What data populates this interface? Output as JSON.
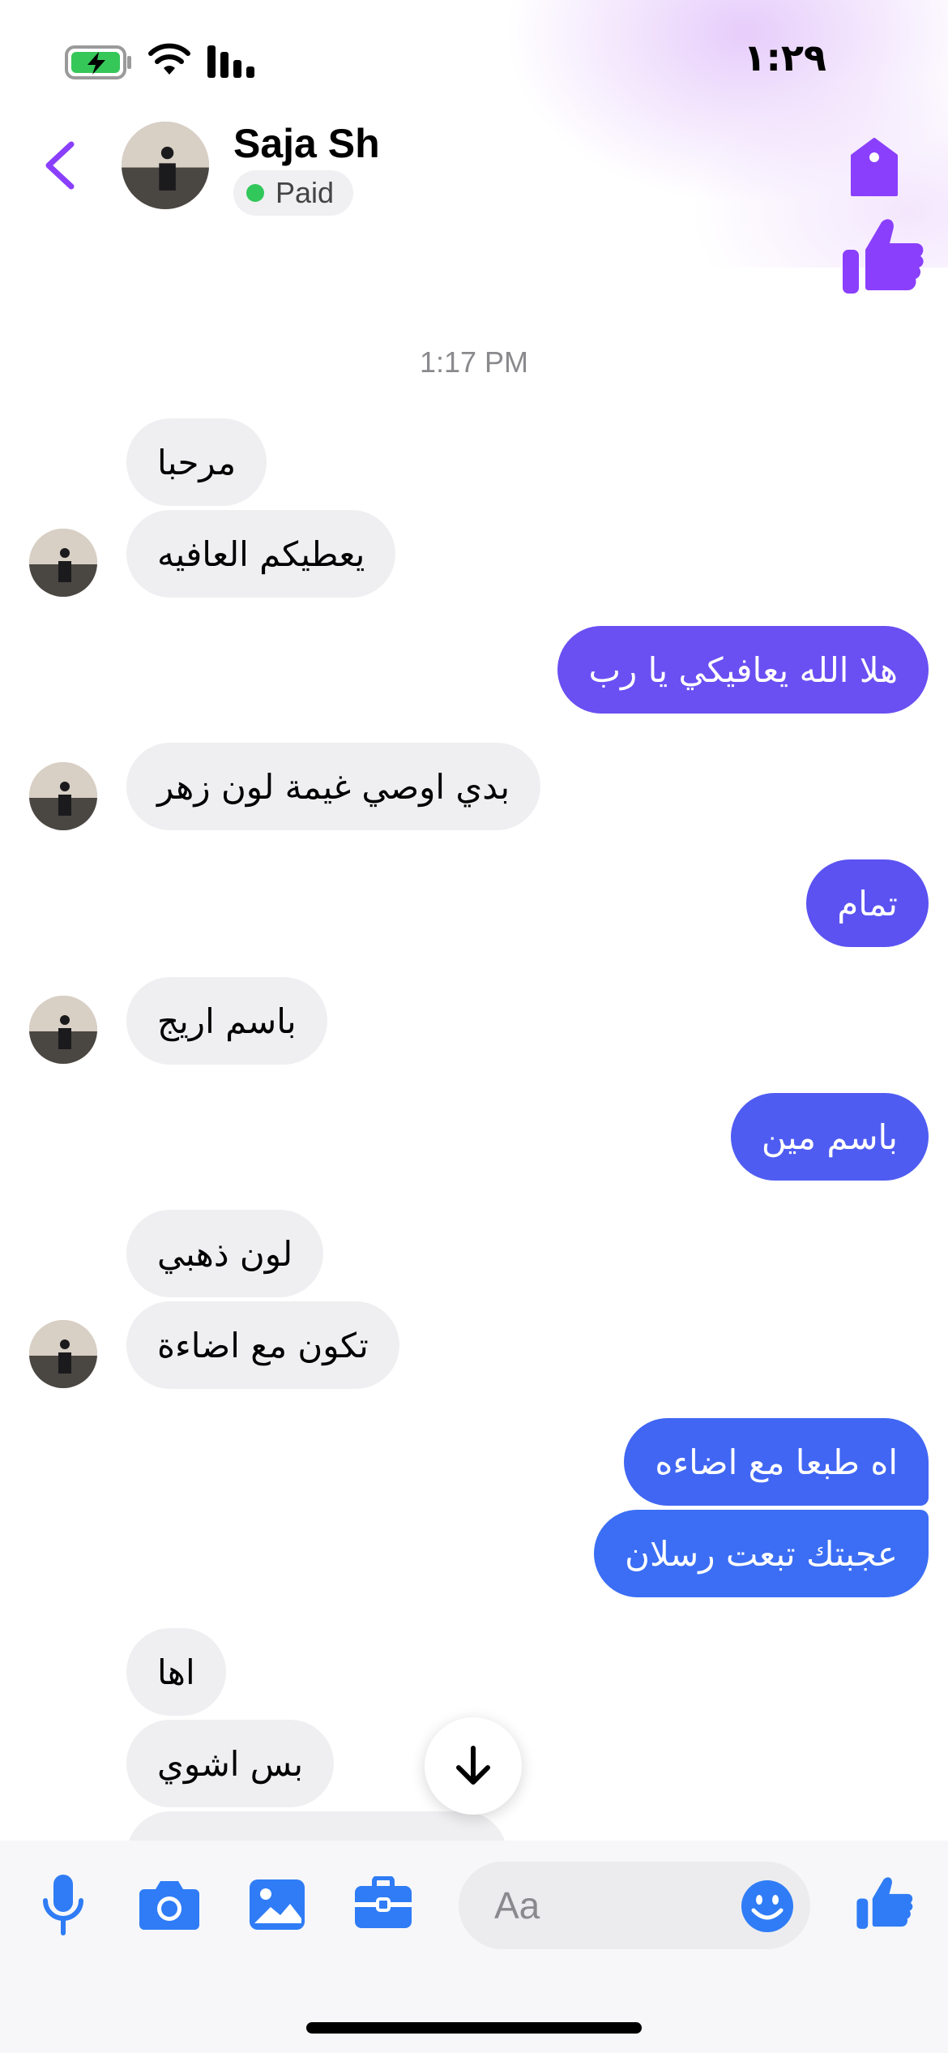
{
  "status_bar": {
    "time": "١:٢٩"
  },
  "header": {
    "contact_name": "Saja Sh",
    "label_tag": "Paid",
    "icons": [
      "back-chevron-icon",
      "tag-icon",
      "thumbs-up-icon"
    ]
  },
  "conversation": {
    "timestamp": "1:17 PM",
    "messages": [
      {
        "direction": "incoming",
        "text": "مرحبا"
      },
      {
        "direction": "incoming",
        "text": "يعطيكم العافيه"
      },
      {
        "direction": "outgoing",
        "text": "هلا الله يعافيكي يا رب"
      },
      {
        "direction": "incoming",
        "text": "بدي اوصي غيمة لون زهر"
      },
      {
        "direction": "outgoing",
        "text": "تمام"
      },
      {
        "direction": "incoming",
        "text": "باسم اريج"
      },
      {
        "direction": "outgoing",
        "text": "باسم مين"
      },
      {
        "direction": "incoming",
        "text": "لون ذهبي"
      },
      {
        "direction": "incoming",
        "text": "تكون مع اضاءة"
      },
      {
        "direction": "outgoing",
        "text": "اه طبعا مع اضاءه"
      },
      {
        "direction": "outgoing",
        "text": "عجبتك تبعت رسلان"
      },
      {
        "direction": "incoming",
        "text": "اها"
      },
      {
        "direction": "incoming",
        "text": "بس اشوي"
      }
    ]
  },
  "composer": {
    "placeholder": "Aa",
    "icons": [
      "microphone-icon",
      "camera-icon",
      "gallery-icon",
      "briefcase-icon",
      "emoji-icon",
      "thumbs-up-icon"
    ]
  },
  "colors": {
    "accent_purple": "#8a3ffc",
    "outgoing_top": "#6a4ff2",
    "outgoing_bottom": "#3b6ef4",
    "composer_blue": "#2f7cf6",
    "incoming_bg": "#efeff1"
  }
}
